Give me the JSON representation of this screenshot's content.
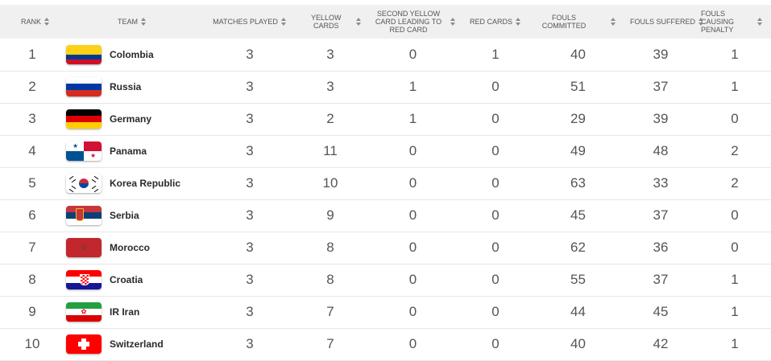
{
  "columns": [
    {
      "label": "RANK"
    },
    {
      "label": "TEAM"
    },
    {
      "label": "MATCHES PLAYED"
    },
    {
      "label": "YELLOW CARDS"
    },
    {
      "label": "SECOND YELLOW CARD LEADING TO RED CARD"
    },
    {
      "label": "RED CARDS"
    },
    {
      "label": "FOULS COMMITTED"
    },
    {
      "label": "FOULS SUFFERED"
    },
    {
      "label": "FOULS CAUSING PENALTY"
    }
  ],
  "rows": [
    {
      "rank": "1",
      "team": "Colombia",
      "flag": "colombia-flag-icon",
      "mp": "3",
      "yc": "3",
      "syc": "0",
      "rc": "1",
      "fc": "40",
      "fs": "39",
      "fcp": "1"
    },
    {
      "rank": "2",
      "team": "Russia",
      "flag": "russia-flag-icon",
      "mp": "3",
      "yc": "3",
      "syc": "1",
      "rc": "0",
      "fc": "51",
      "fs": "37",
      "fcp": "1"
    },
    {
      "rank": "3",
      "team": "Germany",
      "flag": "germany-flag-icon",
      "mp": "3",
      "yc": "2",
      "syc": "1",
      "rc": "0",
      "fc": "29",
      "fs": "39",
      "fcp": "0"
    },
    {
      "rank": "4",
      "team": "Panama",
      "flag": "panama-flag-icon",
      "mp": "3",
      "yc": "11",
      "syc": "0",
      "rc": "0",
      "fc": "49",
      "fs": "48",
      "fcp": "2"
    },
    {
      "rank": "5",
      "team": "Korea Republic",
      "flag": "korea-flag-icon",
      "mp": "3",
      "yc": "10",
      "syc": "0",
      "rc": "0",
      "fc": "63",
      "fs": "33",
      "fcp": "2"
    },
    {
      "rank": "6",
      "team": "Serbia",
      "flag": "serbia-flag-icon",
      "mp": "3",
      "yc": "9",
      "syc": "0",
      "rc": "0",
      "fc": "45",
      "fs": "37",
      "fcp": "0"
    },
    {
      "rank": "7",
      "team": "Morocco",
      "flag": "morocco-flag-icon",
      "mp": "3",
      "yc": "8",
      "syc": "0",
      "rc": "0",
      "fc": "62",
      "fs": "36",
      "fcp": "0"
    },
    {
      "rank": "8",
      "team": "Croatia",
      "flag": "croatia-flag-icon",
      "mp": "3",
      "yc": "8",
      "syc": "0",
      "rc": "0",
      "fc": "55",
      "fs": "37",
      "fcp": "1"
    },
    {
      "rank": "9",
      "team": "IR Iran",
      "flag": "iran-flag-icon",
      "mp": "3",
      "yc": "7",
      "syc": "0",
      "rc": "0",
      "fc": "44",
      "fs": "45",
      "fcp": "1"
    },
    {
      "rank": "10",
      "team": "Switzerland",
      "flag": "switzerland-flag-icon",
      "mp": "3",
      "yc": "7",
      "syc": "0",
      "rc": "0",
      "fc": "40",
      "fs": "42",
      "fcp": "1"
    }
  ],
  "colors": {
    "header_bg": "#f0f0f0",
    "row_border": "#e6e6e6",
    "text": "#555555"
  }
}
